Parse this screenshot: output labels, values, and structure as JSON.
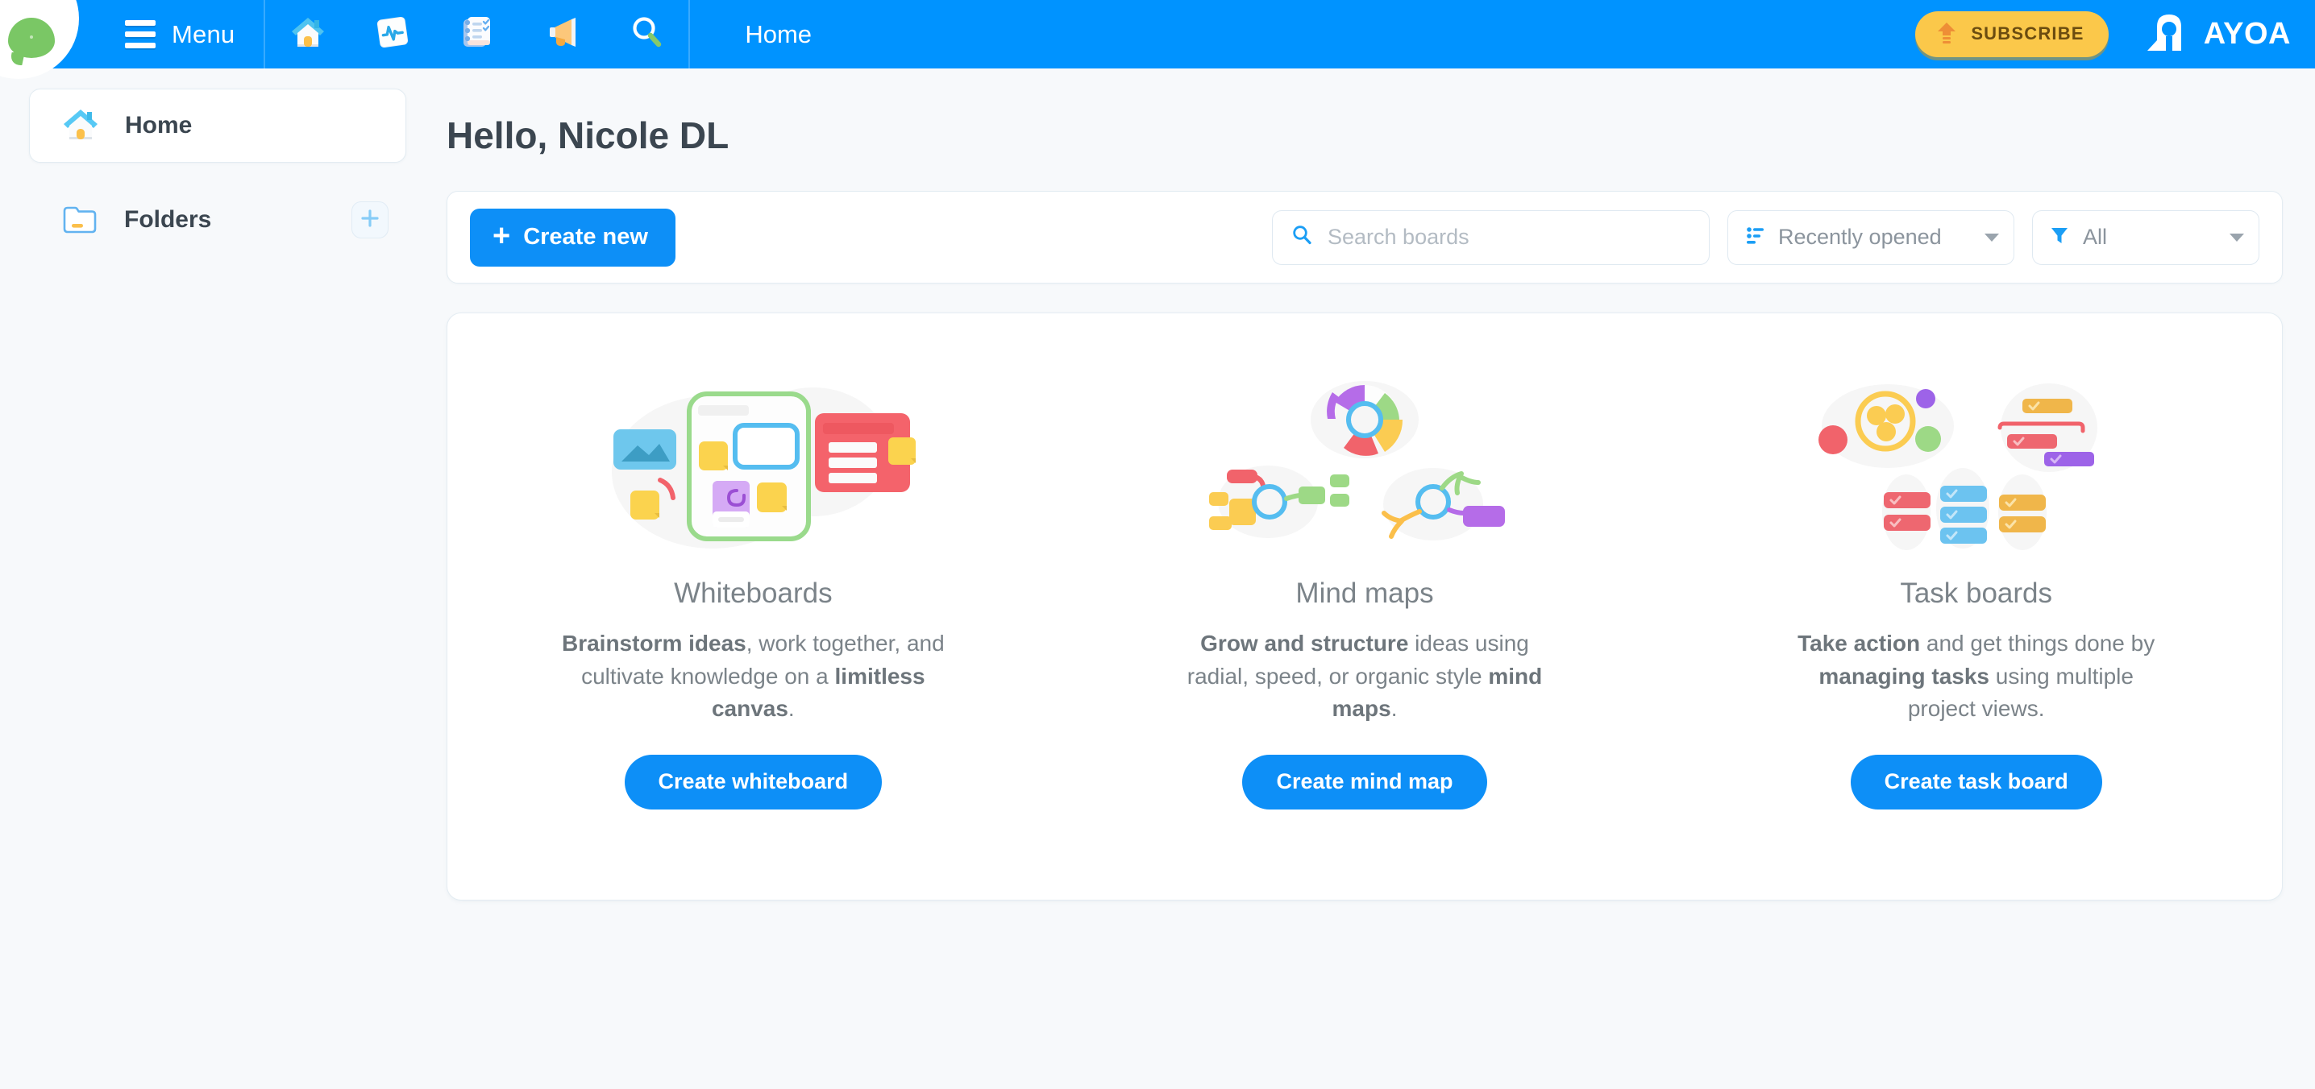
{
  "header": {
    "menu_label": "Menu",
    "breadcrumb": "Home",
    "subscribe_label": "SUBSCRIBE",
    "brand": "AYOA",
    "nav_icons": [
      {
        "name": "home-icon",
        "title": "Home"
      },
      {
        "name": "activity-pulse-icon",
        "title": "Activity"
      },
      {
        "name": "task-list-icon",
        "title": "Tasks"
      },
      {
        "name": "megaphone-icon",
        "title": "Announcements"
      },
      {
        "name": "search-icon",
        "title": "Search"
      }
    ],
    "logo_icon": "chat-bubble-icon",
    "hamburger_icon": "hamburger-menu-icon",
    "upload_icon": "upload-arrow-icon"
  },
  "sidebar": {
    "items": [
      {
        "label": "Home",
        "icon": "house-icon",
        "active": true
      },
      {
        "label": "Folders",
        "icon": "folder-icon",
        "active": false
      }
    ],
    "add_folder_icon": "plus-icon"
  },
  "main": {
    "greeting": "Hello, Nicole DL",
    "toolbar": {
      "create_new_label": "Create new",
      "create_new_icon": "plus-icon",
      "search_placeholder": "Search boards",
      "search_value": "",
      "search_icon": "magnifier-icon",
      "sort_label": "Recently opened",
      "sort_icon": "sort-icon",
      "filter_label": "All",
      "filter_icon": "funnel-icon",
      "caret_icon": "chevron-down-icon"
    },
    "features": [
      {
        "title": "Whiteboards",
        "desc_parts": [
          {
            "text": "Brainstorm ideas",
            "bold": true
          },
          {
            "text": ", work together, and cultivate knowledge on a ",
            "bold": false
          },
          {
            "text": "limitless canvas",
            "bold": true
          },
          {
            "text": ".",
            "bold": false
          }
        ],
        "cta": "Create whiteboard",
        "art": "whiteboards-illustration"
      },
      {
        "title": "Mind maps",
        "desc_parts": [
          {
            "text": "Grow and structure",
            "bold": true
          },
          {
            "text": " ideas using radial, speed, or organic style ",
            "bold": false
          },
          {
            "text": "mind maps",
            "bold": true
          },
          {
            "text": ".",
            "bold": false
          }
        ],
        "cta": "Create mind map",
        "art": "mindmaps-illustration"
      },
      {
        "title": "Task boards",
        "desc_parts": [
          {
            "text": "Take action",
            "bold": true
          },
          {
            "text": " and get things done by ",
            "bold": false
          },
          {
            "text": "managing tasks",
            "bold": true
          },
          {
            "text": " using multiple project views.",
            "bold": false
          }
        ],
        "cta": "Create task board",
        "art": "taskboards-illustration"
      }
    ]
  },
  "colors": {
    "header_blue": "#0093ff",
    "accent_blue": "#0d8ff7",
    "subscribe_yellow": "#fbc84a",
    "page_bg": "#f7f9fb",
    "text_dark": "#3b4650",
    "text_muted": "#7b8389"
  }
}
